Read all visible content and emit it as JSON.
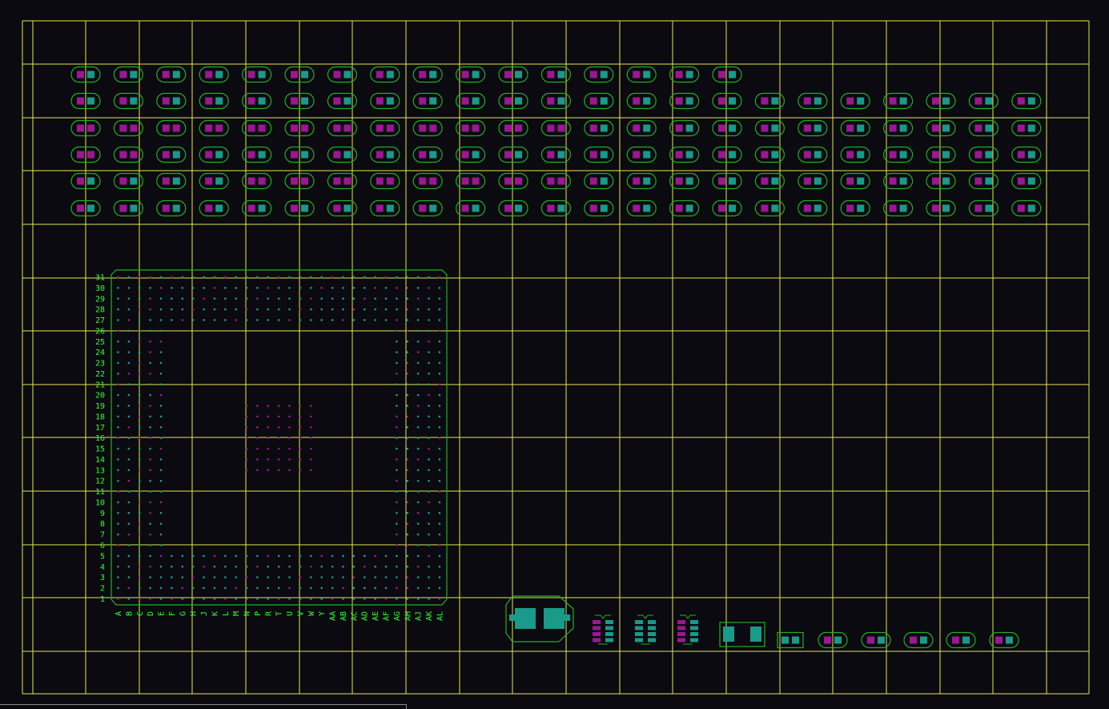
{
  "colors": {
    "background": "#0a0a10",
    "grid": "#e6e64d",
    "outline": "#22b022",
    "pad_teal": "#1a9a88",
    "pad_magenta": "#9a1890",
    "label": "#33ff33"
  },
  "bga": {
    "row_labels": [
      "31",
      "30",
      "29",
      "28",
      "27",
      "26",
      "25",
      "24",
      "23",
      "22",
      "21",
      "20",
      "19",
      "18",
      "17",
      "16",
      "15",
      "14",
      "13",
      "12",
      "11",
      "10",
      "9",
      "8",
      "7",
      "6",
      "5",
      "4",
      "3",
      "2",
      "1"
    ],
    "col_labels": [
      "A",
      "B",
      "C",
      "D",
      "E",
      "F",
      "G",
      "H",
      "J",
      "K",
      "L",
      "M",
      "N",
      "P",
      "R",
      "T",
      "U",
      "V",
      "W",
      "Y",
      "AA",
      "AB",
      "AC",
      "AD",
      "AE",
      "AF",
      "AG",
      "AH",
      "AJ",
      "AK",
      "AL"
    ]
  },
  "pad_rows": [
    {
      "count": 16
    },
    {
      "count": 23
    },
    {
      "count": 23
    },
    {
      "count": 23
    },
    {
      "count": 23
    },
    {
      "count": 23
    }
  ],
  "bottom_components": {
    "soic_count": 3,
    "small_pad_count": 6
  }
}
